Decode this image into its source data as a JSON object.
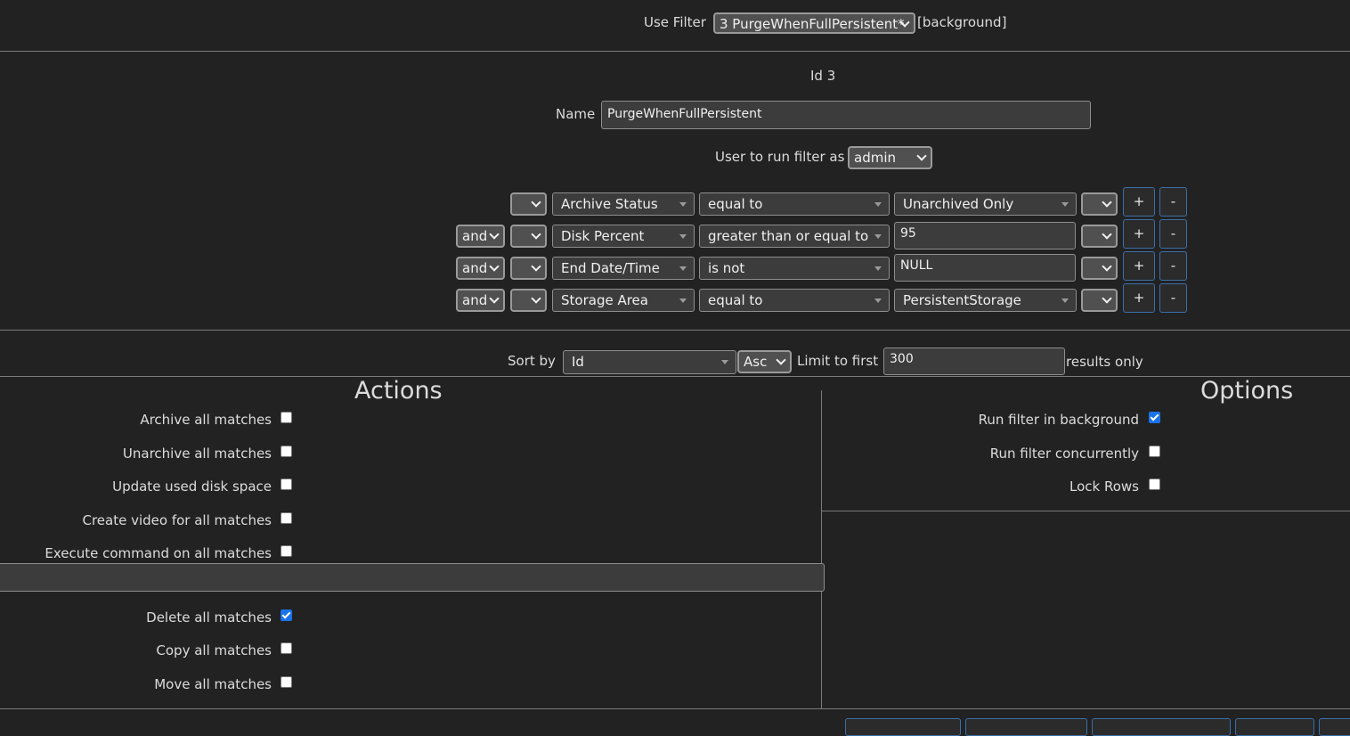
{
  "filter_bar": {
    "use_filter_label": "Use Filter",
    "selected_filter": "3 PurgeWhenFullPersistent*",
    "background_tag": "[background]"
  },
  "filter": {
    "id_text": "Id 3",
    "name_label": "Name",
    "name_value": "PurgeWhenFullPersistent",
    "user_label": "User to run filter as",
    "user_value": "admin"
  },
  "terms": [
    {
      "conjunction": "",
      "open_paren": "",
      "attribute": "Archive Status",
      "operator": "equal to",
      "value": "Unarchived Only",
      "value_type": "select",
      "close_paren": ""
    },
    {
      "conjunction": "and",
      "open_paren": "",
      "attribute": "Disk Percent",
      "operator": "greater than or equal to",
      "value": "95",
      "value_type": "input",
      "close_paren": ""
    },
    {
      "conjunction": "and",
      "open_paren": "",
      "attribute": "End Date/Time",
      "operator": "is not",
      "value": "NULL",
      "value_type": "input",
      "close_paren": ""
    },
    {
      "conjunction": "and",
      "open_paren": "",
      "attribute": "Storage Area",
      "operator": "equal to",
      "value": "PersistentStorage",
      "value_type": "select",
      "close_paren": ""
    }
  ],
  "term_buttons": {
    "add": "+",
    "remove": "-"
  },
  "sort": {
    "sort_label": "Sort by",
    "sort_field": "Id",
    "sort_dir": "Asc",
    "limit_label": "Limit to first",
    "limit_value": "300",
    "limit_suffix": "results only"
  },
  "actions": {
    "title": "Actions",
    "items": [
      {
        "label": "Archive all matches",
        "checked": false
      },
      {
        "label": "Unarchive all matches",
        "checked": false
      },
      {
        "label": "Update used disk space",
        "checked": false
      },
      {
        "label": "Create video for all matches",
        "checked": false
      },
      {
        "label": "Execute command on all matches",
        "checked": false
      },
      {
        "label": "Delete all matches",
        "checked": true
      },
      {
        "label": "Copy all matches",
        "checked": false
      },
      {
        "label": "Move all matches",
        "checked": false
      }
    ],
    "command_value": ""
  },
  "options": {
    "title": "Options",
    "items": [
      {
        "label": "Run filter in background",
        "checked": true
      },
      {
        "label": "Run filter concurrently",
        "checked": false
      },
      {
        "label": "Lock Rows",
        "checked": false
      }
    ]
  },
  "colors": {
    "background": "#222222",
    "accent": "#3a6fa8",
    "checkbox_checked": "#1a73e8"
  }
}
